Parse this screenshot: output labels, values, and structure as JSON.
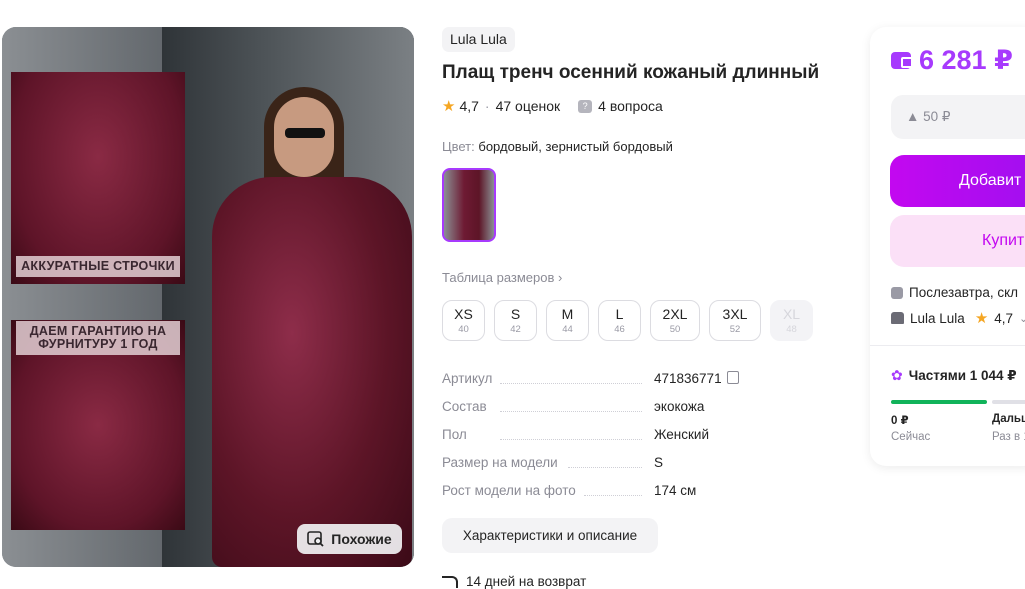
{
  "gallery": {
    "inset_caption_1": "АККУРАТНЫЕ СТРОЧКИ",
    "inset_caption_2": "ДАЕМ ГАРАНТИЮ НА ФУРНИТУРУ 1 ГОД",
    "similar_label": "Похожие"
  },
  "product": {
    "brand": "Lula Lula",
    "title": "Плащ тренч осенний кожаный длинный",
    "rating": "4,7",
    "reviews": "47 оценок",
    "questions": "4 вопроса",
    "color_label": "Цвет:",
    "color_value": "бордовый, зернистый бордовый",
    "size_table_link": "Таблица размеров",
    "sizes": [
      {
        "name": "XS",
        "code": "40",
        "available": true
      },
      {
        "name": "S",
        "code": "42",
        "available": true
      },
      {
        "name": "M",
        "code": "44",
        "available": true
      },
      {
        "name": "L",
        "code": "46",
        "available": true
      },
      {
        "name": "2XL",
        "code": "50",
        "available": true
      },
      {
        "name": "3XL",
        "code": "52",
        "available": true
      },
      {
        "name": "XL",
        "code": "48",
        "available": false
      }
    ],
    "specs": [
      {
        "key": "Артикул",
        "value": "471836771"
      },
      {
        "key": "Состав",
        "value": "экокожа"
      },
      {
        "key": "Пол",
        "value": "Женский"
      },
      {
        "key": "Размер на модели",
        "value": "S"
      },
      {
        "key": "Рост модели на фото",
        "value": "174 см"
      }
    ],
    "details_button": "Характеристики и описание",
    "return_text": "14 дней на возврат"
  },
  "buy_box": {
    "price": "6 281 ₽",
    "price_tail": "",
    "extra": "▲ 50 ₽",
    "add_button": "Добавит",
    "buy_button": "Купит",
    "delivery": "Послезавтра, скл",
    "seller": "Lula Lula",
    "seller_rating": "4,7",
    "installment": "Частями 1 044 ₽",
    "pay_now_amount": "0 ₽",
    "pay_now_label": "Сейчас",
    "pay_later_amount": "Дальш",
    "pay_later_label": "Раз в 1"
  },
  "colors": {
    "accent": "#a73afd",
    "button_gradient_start": "#c308f0",
    "buy_bg": "#fbe0f7",
    "progress": "#11b35a"
  }
}
